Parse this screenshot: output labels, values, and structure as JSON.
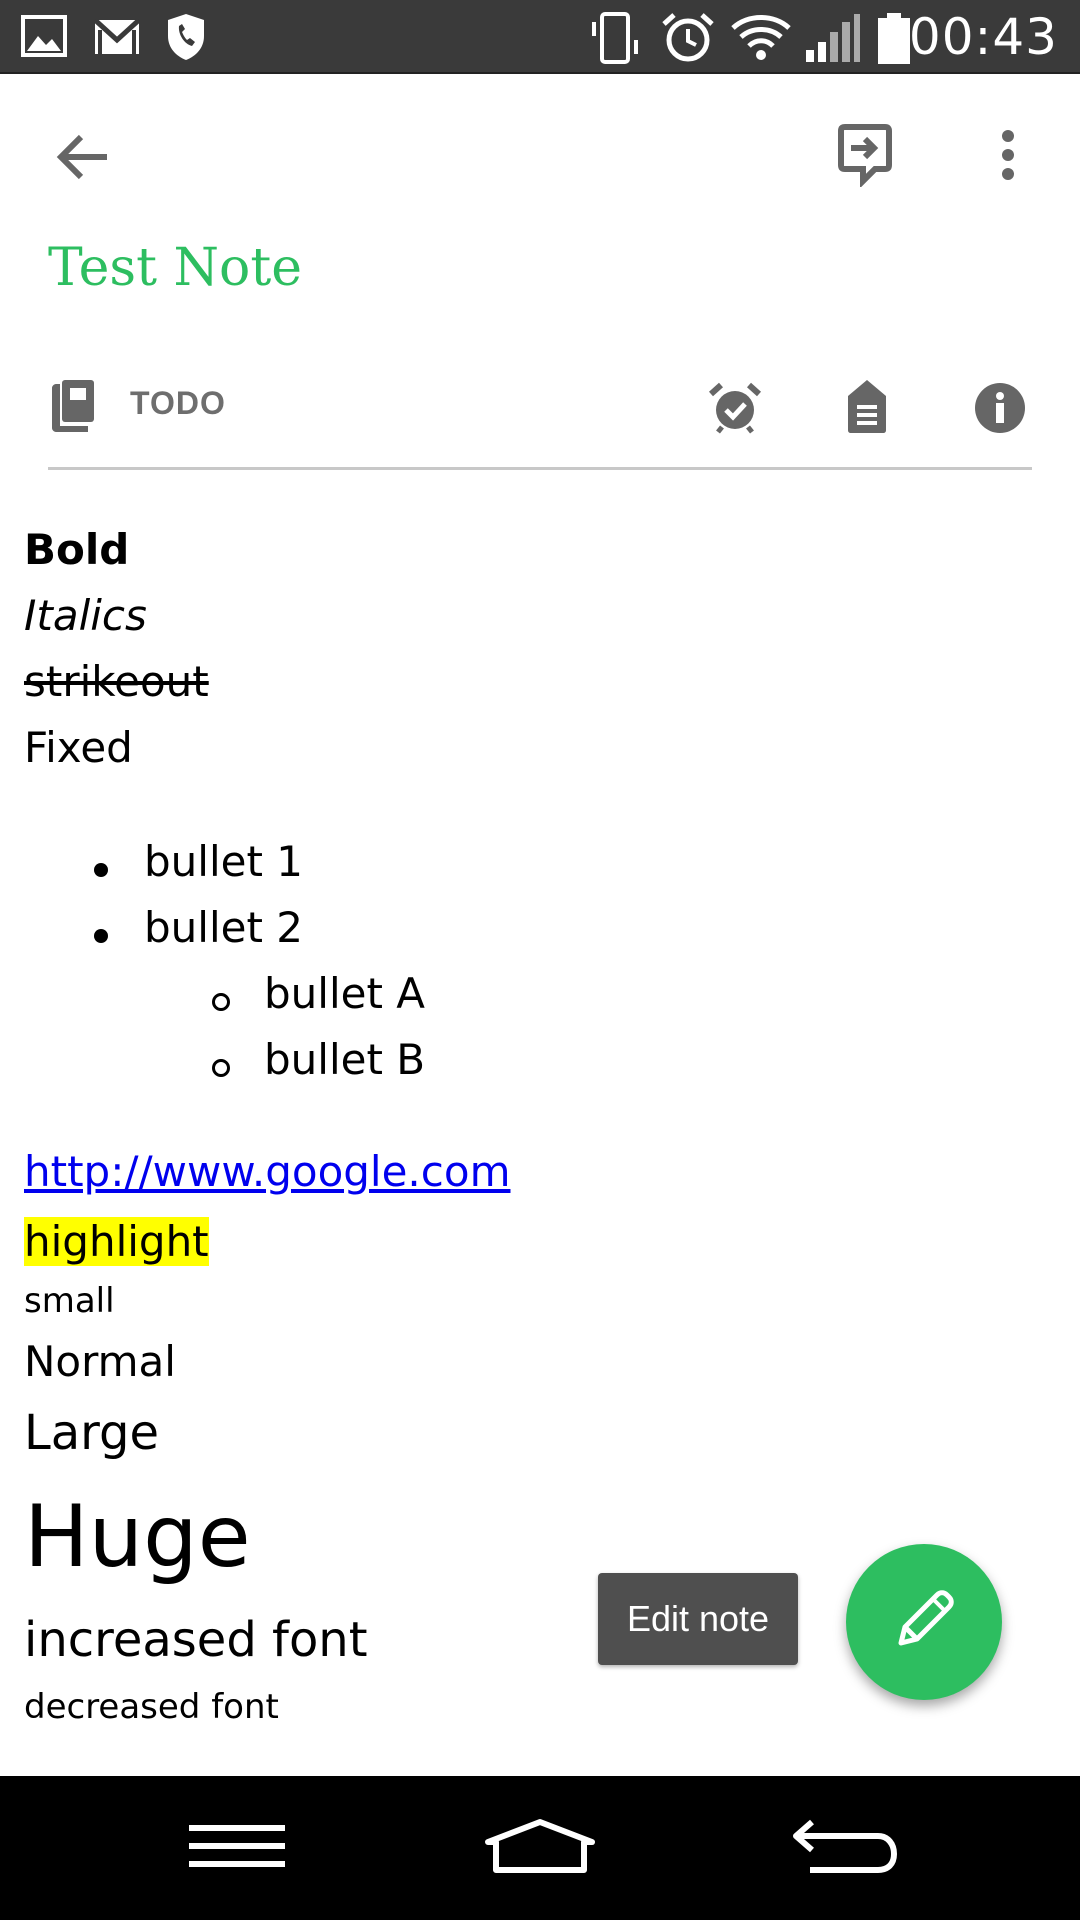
{
  "status_bar": {
    "time": "00:43",
    "left_icons": [
      "image-icon",
      "gmail-icon",
      "shield-phone-icon"
    ],
    "right_icons": [
      "vibrate-icon",
      "alarm-icon",
      "wifi-icon",
      "signal-icon",
      "battery-icon"
    ]
  },
  "toolbar": {
    "back_icon": "arrow-back-icon",
    "share_icon": "share-icon",
    "more_icon": "more-vert-icon"
  },
  "note": {
    "title": "Test Note",
    "notebook": "TODO"
  },
  "content": {
    "bold": "Bold",
    "italics": "Italics",
    "strikeout": "strikeout",
    "fixed": "Fixed",
    "bullets": [
      "bullet 1",
      "bullet 2"
    ],
    "sub_bullets": [
      "bullet A",
      "bullet B"
    ],
    "link": "http://www.google.com",
    "highlight": "highlight",
    "small": "small",
    "normal": "Normal",
    "large": "Large",
    "huge": "Huge",
    "increased": "increased font",
    "decreased": "decreased font"
  },
  "tooltip": "Edit note",
  "colors": {
    "accent": "#2dbe60",
    "status_bar": "#3a3a3a",
    "highlight": "#ffff00",
    "link": "#0000ee"
  }
}
